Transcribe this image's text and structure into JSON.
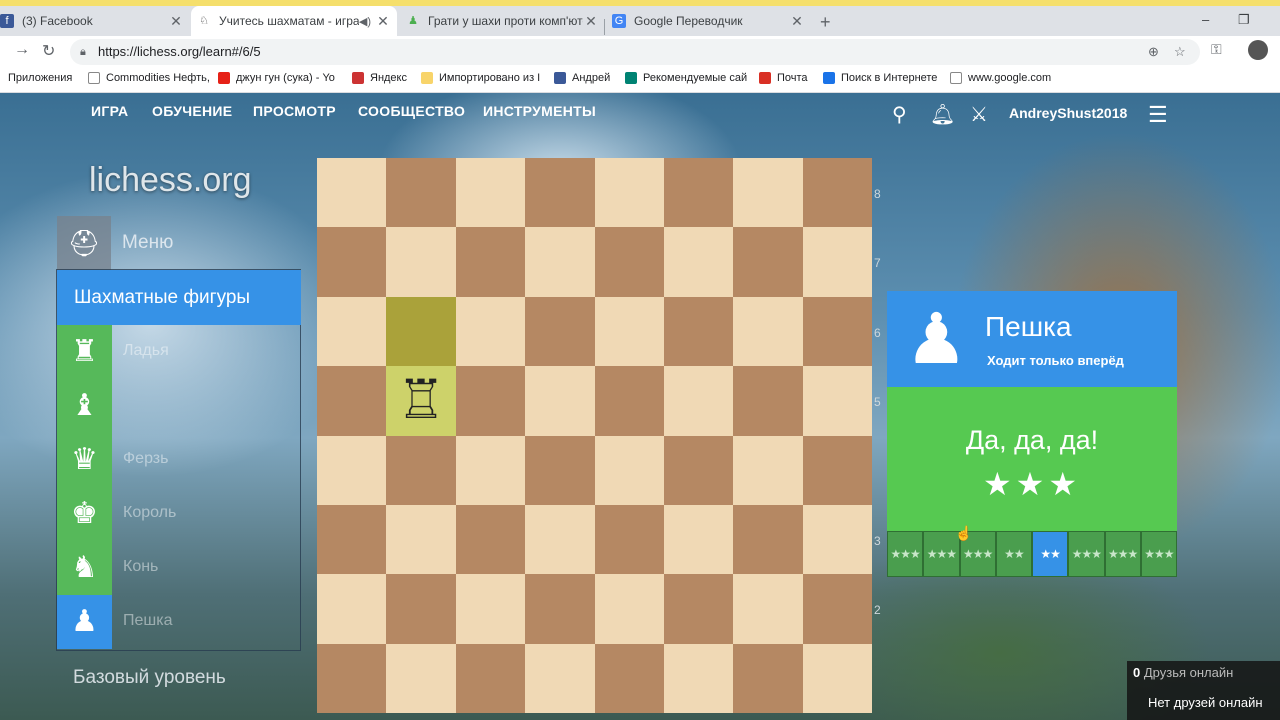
{
  "browser": {
    "tabs": [
      {
        "title": "(3) Facebook",
        "active": false
      },
      {
        "title": "Учитесь шахматам - играя!",
        "active": true,
        "audio_icon": "speaker-icon"
      },
      {
        "title": "Грати у шахи проти комп'ютера",
        "active": false
      },
      {
        "title": "Google Переводчик",
        "active": false
      }
    ],
    "new_tab": "+",
    "window_controls": [
      "–",
      "❐",
      "✕"
    ],
    "url": "https://lichess.org/learn#/6/5",
    "bookmarks": [
      {
        "label": "Приложения",
        "icon": "apps-icon"
      },
      {
        "label": "Commodities Нефть,",
        "icon": "page-icon"
      },
      {
        "label": "джун гун (сука) - Yo",
        "icon": "youtube-icon"
      },
      {
        "label": "Яндекс",
        "icon": "yandex-icon"
      },
      {
        "label": "Импортировано из I",
        "icon": "folder-icon"
      },
      {
        "label": "Андрей",
        "icon": "facebook-icon"
      },
      {
        "label": "Рекомендуемые сай",
        "icon": "bing-icon"
      },
      {
        "label": "Почта",
        "icon": "gmail-icon"
      },
      {
        "label": "Поиск в Интернете",
        "icon": "search-icon"
      },
      {
        "label": "www.google.com",
        "icon": "page-icon"
      }
    ]
  },
  "site": {
    "nav": [
      "ИГРА",
      "ОБУЧЕНИЕ",
      "ПРОСМОТР",
      "СООБЩЕСТВО",
      "ИНСТРУМЕНТЫ"
    ],
    "username": "AndreyShust2018",
    "logo": "lichess.org",
    "menu_label": "Меню",
    "lesson_panel": {
      "title": "Шахматные фигуры",
      "items": [
        {
          "label": "Ладья",
          "icon": "♜",
          "active": false
        },
        {
          "label": "",
          "icon": "♝",
          "active": false
        },
        {
          "label": "Ферзь",
          "icon": "♛",
          "active": false
        },
        {
          "label": "Король",
          "icon": "♚",
          "active": false
        },
        {
          "label": "Конь",
          "icon": "♞",
          "active": false
        },
        {
          "label": "Пешка",
          "icon": "♟",
          "active": true
        }
      ]
    },
    "basic_level": "Базовый уровень",
    "board": {
      "ranks": [
        "8",
        "7",
        "6",
        "5",
        "3",
        "2"
      ],
      "highlight_from": "b6",
      "highlight_to": "b5",
      "pieces": [
        {
          "square": "b5",
          "piece": "♖"
        }
      ]
    },
    "result": {
      "title": "Пешка",
      "subtitle": "Ходит только вперёд",
      "message": "Да, да, да!",
      "stars": "★★★",
      "steps": [
        {
          "stars": "★★★",
          "active": false
        },
        {
          "stars": "★★★",
          "active": false
        },
        {
          "stars": "★★★",
          "active": false
        },
        {
          "stars": "★★",
          "active": false
        },
        {
          "stars": "★★",
          "active": true
        },
        {
          "stars": "★★★",
          "active": false
        },
        {
          "stars": "★★★",
          "active": false
        },
        {
          "stars": "★★★",
          "active": false
        }
      ]
    },
    "friends": {
      "count": "0",
      "label": "Друзья онлайн",
      "none": "Нет друзей онлайн"
    }
  }
}
